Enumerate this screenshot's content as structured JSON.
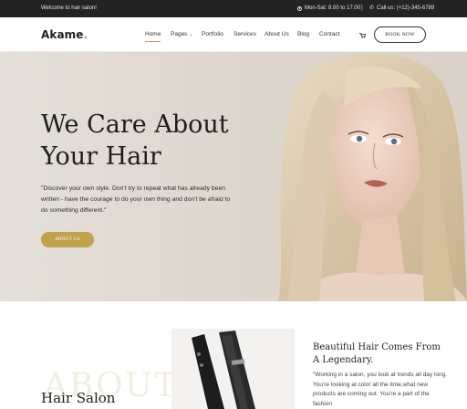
{
  "topbar": {
    "welcome": "Welcome to hair salon!",
    "hours": "Mon-Sat: 8.00 to 17.00",
    "separator": "|",
    "phone": "Call us: (+12)-345-6789"
  },
  "navbar": {
    "logo": "Akame",
    "logo_dot": ".",
    "items": [
      {
        "label": "Home",
        "active": true
      },
      {
        "label": "Pages",
        "has_dropdown": true
      },
      {
        "label": "Portfolio"
      },
      {
        "label": "Services"
      },
      {
        "label": "About Us"
      },
      {
        "label": "Blog"
      },
      {
        "label": "Contact"
      }
    ],
    "book_label": "BOOK NOW"
  },
  "hero": {
    "title_line1": "We Care About",
    "title_line2": "Your Hair",
    "text": "\"Discover your own style. Don't try to repeat what has already been written - have the courage to do your own thing and don't be afraid to do something different.\"",
    "button_label": "ABOUT US"
  },
  "about": {
    "ghost_text": "ABOUT",
    "heading": "Hair Salon",
    "right_title": "Beautiful Hair Comes From A Legendary.",
    "right_text": "\"Working in a salon, you look at trends all day long. You're looking at color all the time,what new products are coming out. You're a part of the fashion"
  },
  "colors": {
    "accent": "#c2a14d",
    "topbar_bg": "#232323",
    "hero_bg": "#e0dad2"
  },
  "icons": {
    "hours": "clock-icon",
    "phone": "phone-icon",
    "dropdown": "chevron-down-icon",
    "cart": "cart-icon"
  }
}
